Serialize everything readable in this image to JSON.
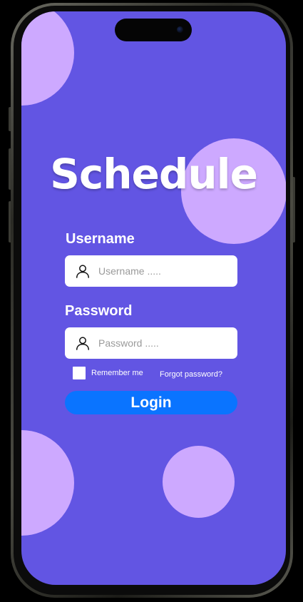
{
  "app": {
    "title": "Schedule"
  },
  "login_form": {
    "username_label": "Username",
    "username_placeholder": "Username .....",
    "username_value": "",
    "password_label": "Password",
    "password_placeholder": "Password .....",
    "password_value": "",
    "remember_label": "Remember me",
    "remember_checked": false,
    "forgot_label": "Forgot password?",
    "login_label": "Login"
  },
  "icons": {
    "username_field_icon": "user-icon",
    "password_field_icon": "user-icon"
  },
  "colors": {
    "background": "#6255e3",
    "decor_circles": "#cda9ff",
    "login_button": "#0a74ff",
    "text": "#ffffff"
  }
}
